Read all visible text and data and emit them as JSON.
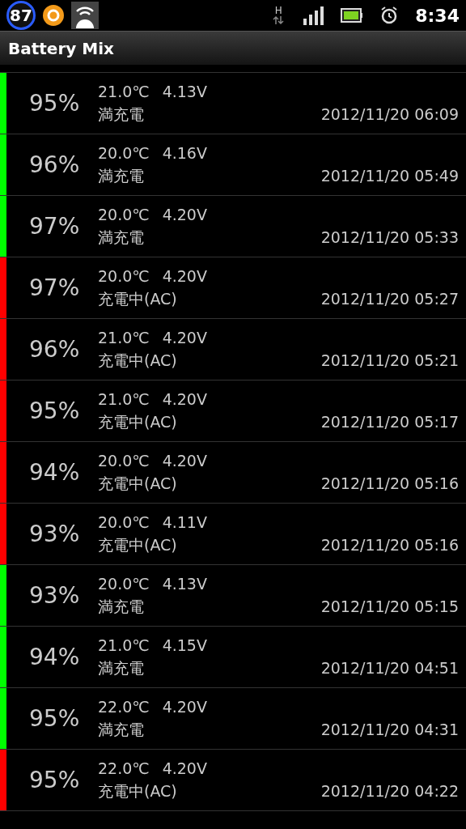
{
  "status_bar": {
    "badge": "87",
    "network": "H",
    "time": "8:34"
  },
  "title": "Battery Mix",
  "rows": [
    {
      "percent": "95%",
      "temperature": "21.0℃",
      "voltage": "4.13V",
      "status": "満充電",
      "time": "2012/11/20 06:09",
      "color": "#00ff00"
    },
    {
      "percent": "96%",
      "temperature": "20.0℃",
      "voltage": "4.16V",
      "status": "満充電",
      "time": "2012/11/20 05:49",
      "color": "#00ff00"
    },
    {
      "percent": "97%",
      "temperature": "20.0℃",
      "voltage": "4.20V",
      "status": "満充電",
      "time": "2012/11/20 05:33",
      "color": "#00ff00"
    },
    {
      "percent": "97%",
      "temperature": "20.0℃",
      "voltage": "4.20V",
      "status": "充電中(AC)",
      "time": "2012/11/20 05:27",
      "color": "#ff0000"
    },
    {
      "percent": "96%",
      "temperature": "21.0℃",
      "voltage": "4.20V",
      "status": "充電中(AC)",
      "time": "2012/11/20 05:21",
      "color": "#ff0000"
    },
    {
      "percent": "95%",
      "temperature": "21.0℃",
      "voltage": "4.20V",
      "status": "充電中(AC)",
      "time": "2012/11/20 05:17",
      "color": "#ff0000"
    },
    {
      "percent": "94%",
      "temperature": "20.0℃",
      "voltage": "4.20V",
      "status": "充電中(AC)",
      "time": "2012/11/20 05:16",
      "color": "#ff0000"
    },
    {
      "percent": "93%",
      "temperature": "20.0℃",
      "voltage": "4.11V",
      "status": "充電中(AC)",
      "time": "2012/11/20 05:16",
      "color": "#ff0000"
    },
    {
      "percent": "93%",
      "temperature": "20.0℃",
      "voltage": "4.13V",
      "status": "満充電",
      "time": "2012/11/20 05:15",
      "color": "#00ff00"
    },
    {
      "percent": "94%",
      "temperature": "21.0℃",
      "voltage": "4.15V",
      "status": "満充電",
      "time": "2012/11/20 04:51",
      "color": "#00ff00"
    },
    {
      "percent": "95%",
      "temperature": "22.0℃",
      "voltage": "4.20V",
      "status": "満充電",
      "time": "2012/11/20 04:31",
      "color": "#00ff00"
    },
    {
      "percent": "95%",
      "temperature": "22.0℃",
      "voltage": "4.20V",
      "status": "充電中(AC)",
      "time": "2012/11/20 04:22",
      "color": "#ff0000"
    }
  ]
}
